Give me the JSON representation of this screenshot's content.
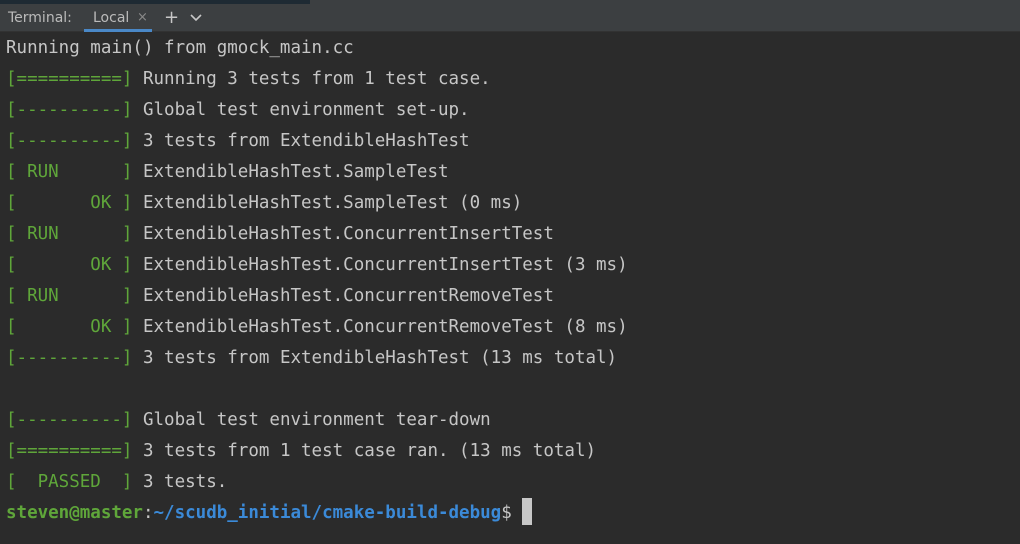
{
  "tabbar": {
    "title": "Terminal:",
    "tabs": [
      {
        "label": "Local",
        "close_glyph": "×"
      }
    ],
    "add_glyph": "+",
    "menu_icon": "chevron-down-icon"
  },
  "terminal": {
    "lines": [
      {
        "marker": "",
        "text": "Running main() from gmock_main.cc"
      },
      {
        "marker": "[==========]",
        "text": " Running 3 tests from 1 test case."
      },
      {
        "marker": "[----------]",
        "text": " Global test environment set-up."
      },
      {
        "marker": "[----------]",
        "text": " 3 tests from ExtendibleHashTest"
      },
      {
        "marker": "[ RUN      ]",
        "text": " ExtendibleHashTest.SampleTest"
      },
      {
        "marker": "[       OK ]",
        "text": " ExtendibleHashTest.SampleTest (0 ms)"
      },
      {
        "marker": "[ RUN      ]",
        "text": " ExtendibleHashTest.ConcurrentInsertTest"
      },
      {
        "marker": "[       OK ]",
        "text": " ExtendibleHashTest.ConcurrentInsertTest (3 ms)"
      },
      {
        "marker": "[ RUN      ]",
        "text": " ExtendibleHashTest.ConcurrentRemoveTest"
      },
      {
        "marker": "[       OK ]",
        "text": " ExtendibleHashTest.ConcurrentRemoveTest (8 ms)"
      },
      {
        "marker": "[----------]",
        "text": " 3 tests from ExtendibleHashTest (13 ms total)"
      },
      {
        "marker": "",
        "text": ""
      },
      {
        "marker": "[----------]",
        "text": " Global test environment tear-down"
      },
      {
        "marker": "[==========]",
        "text": " 3 tests from 1 test case ran. (13 ms total)"
      },
      {
        "marker": "[  PASSED  ]",
        "text": " 3 tests."
      }
    ],
    "prompt": {
      "user_host": "steven@master",
      "colon": ":",
      "path": "~/scudb_initial/cmake-build-debug",
      "dollar": "$"
    }
  },
  "colors": {
    "background": "#2b2b2b",
    "marker_green": "#5fa63a",
    "path_blue": "#3b8ad8",
    "tab_underline": "#4a88c7"
  }
}
